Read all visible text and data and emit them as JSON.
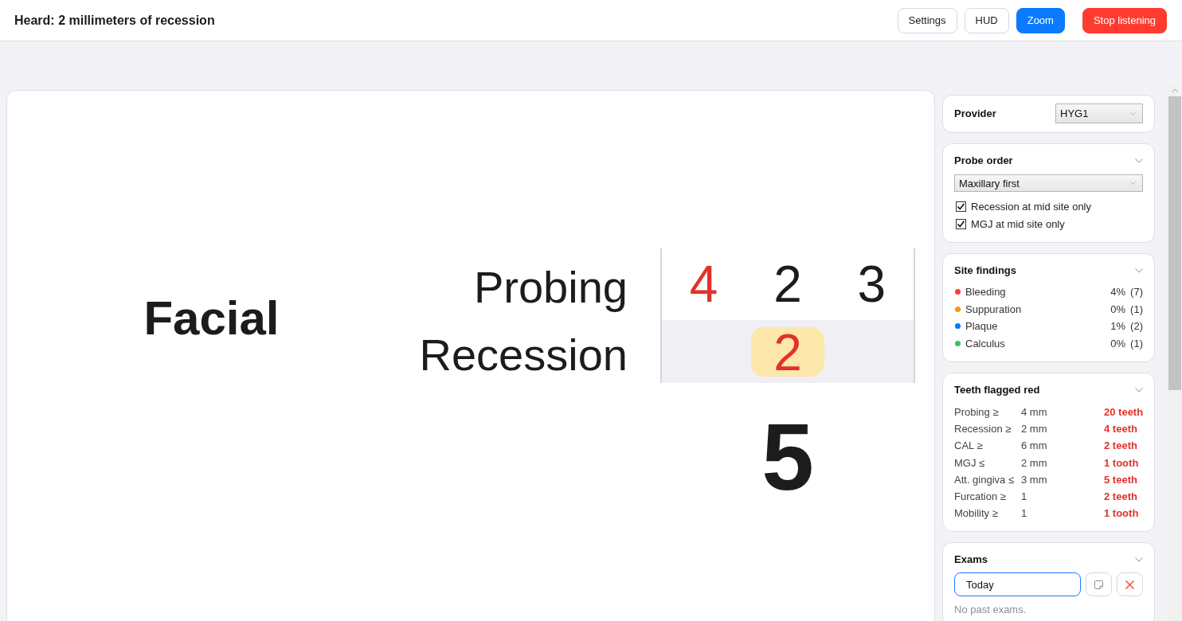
{
  "header": {
    "title": "Heard: 2 millimeters of recession",
    "buttons": [
      {
        "label": "Settings",
        "kind": "default"
      },
      {
        "label": "HUD",
        "kind": "default"
      },
      {
        "label": "Zoom",
        "kind": "primary"
      },
      {
        "label": "Stop listening",
        "kind": "danger"
      }
    ]
  },
  "zoom_view": {
    "surface": "Facial",
    "rows": [
      {
        "label": "Probing",
        "active": false,
        "cells": [
          {
            "kind": "reading",
            "value": "4",
            "flagged": true,
            "selected": false
          },
          {
            "kind": "reading",
            "value": "2",
            "flagged": false,
            "selected": false
          },
          {
            "kind": "reading",
            "value": "3",
            "flagged": false,
            "selected": false
          }
        ]
      },
      {
        "label": "Recession",
        "active": true,
        "cells": [
          {
            "kind": "blank"
          },
          {
            "kind": "reading",
            "value": "2",
            "flagged": true,
            "selected": true
          },
          {
            "kind": "blank"
          }
        ]
      }
    ],
    "tooth": "5"
  },
  "sidebar": {
    "provider": {
      "label": "Provider",
      "value": "HYG1"
    },
    "probe_order": {
      "title": "Probe order",
      "value": "Maxillary first",
      "options": [
        {
          "label": "Recession at mid site only",
          "checked": true
        },
        {
          "label": "MGJ at mid site only",
          "checked": true
        }
      ]
    },
    "site_findings": {
      "title": "Site findings",
      "items": [
        {
          "label": "Bleeding",
          "color": "#ff3b30",
          "percent": "4%",
          "count": "(7)"
        },
        {
          "label": "Suppuration",
          "color": "#ff9500",
          "percent": "0%",
          "count": "(1)"
        },
        {
          "label": "Plaque",
          "color": "#007aff",
          "percent": "1%",
          "count": "(2)"
        },
        {
          "label": "Calculus",
          "color": "#34c759",
          "percent": "0%",
          "count": "(1)"
        }
      ]
    },
    "teeth_flagged": {
      "title": "Teeth flagged red",
      "rows": [
        {
          "label": "Probing ≥",
          "threshold": "4 mm",
          "result": "20 teeth"
        },
        {
          "label": "Recession ≥",
          "threshold": "2 mm",
          "result": "4 teeth"
        },
        {
          "label": "CAL ≥",
          "threshold": "6 mm",
          "result": "2 teeth"
        },
        {
          "label": "MGJ ≤",
          "threshold": "2 mm",
          "result": "1 tooth"
        },
        {
          "label": "Att. gingiva ≤",
          "threshold": "3 mm",
          "result": "5 teeth"
        },
        {
          "label": "Furcation ≥",
          "threshold": "1",
          "result": "2 teeth"
        },
        {
          "label": "Mobility ≥",
          "threshold": "1",
          "result": "1 tooth"
        }
      ]
    },
    "exams": {
      "title": "Exams",
      "current": {
        "value": "Today",
        "focused": true
      },
      "empty_text": "No past exams."
    }
  }
}
